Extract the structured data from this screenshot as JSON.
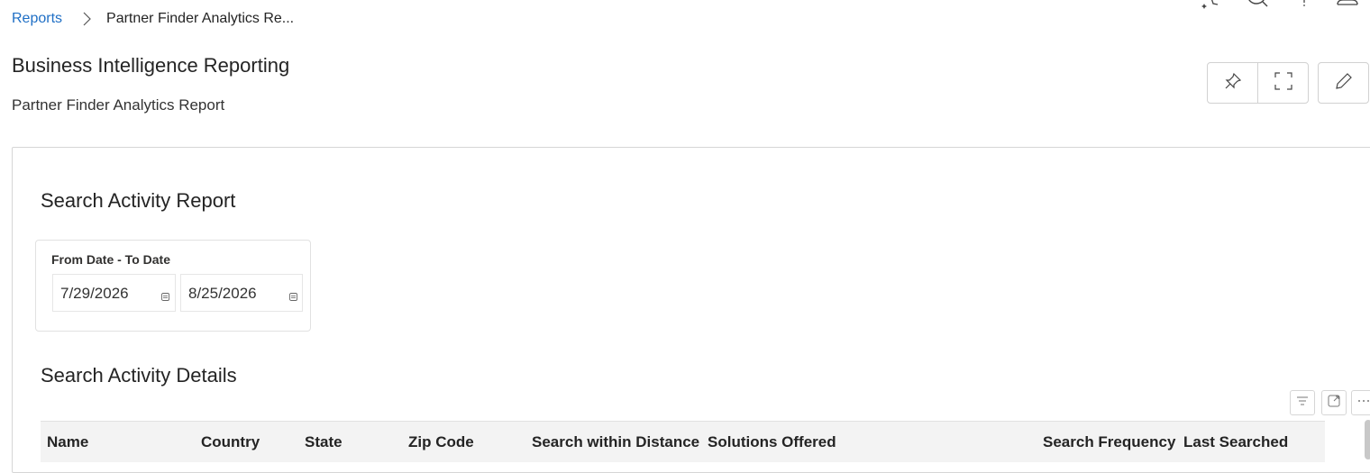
{
  "breadcrumb": {
    "root": "Reports",
    "current": "Partner Finder Analytics Re..."
  },
  "page": {
    "title": "Business Intelligence Reporting",
    "subtitle": "Partner Finder Analytics Report"
  },
  "report": {
    "section_title": "Search Activity Report",
    "filter": {
      "label": "From Date - To Date",
      "from": "7/29/2026",
      "to": "8/25/2026"
    },
    "details_title": "Search Activity Details",
    "table": {
      "columns": [
        "Name",
        "Country",
        "State",
        "Zip Code",
        "Search within Distance",
        "Solutions Offered",
        "Search Frequency",
        "Last Searched"
      ]
    }
  },
  "icons": {
    "breadcrumb_separator": "chevron-right-icon",
    "pin": "pin-icon",
    "fullscreen": "expand-icon",
    "edit": "pencil-icon",
    "filter": "filter-icon",
    "popout": "popout-icon",
    "more": "more-icon",
    "calendar": "calendar-icon"
  },
  "colors": {
    "link": "#1f6fc5",
    "header_bg": "#f3f3f3",
    "border": "#d6d6d6"
  }
}
